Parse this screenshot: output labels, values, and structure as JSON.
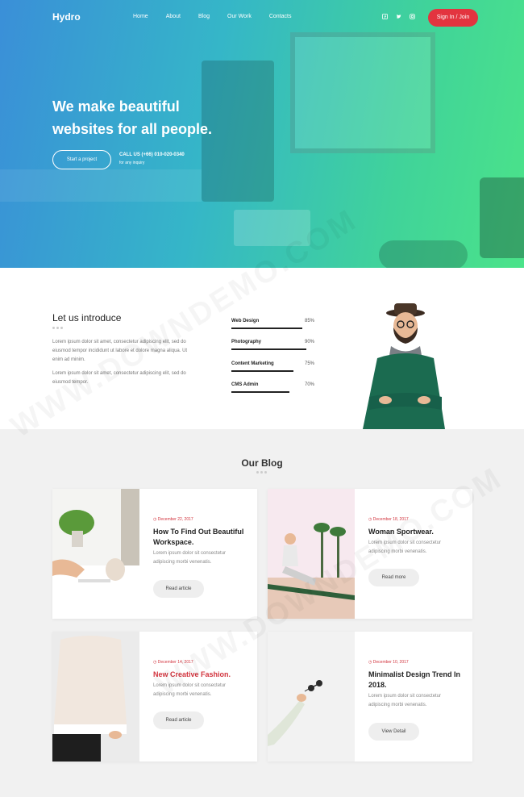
{
  "header": {
    "logo": "Hydro",
    "nav": [
      "Home",
      "About",
      "Blog",
      "Our Work",
      "Contacts"
    ],
    "social_icons": [
      "facebook-icon",
      "twitter-icon",
      "instagram-icon"
    ],
    "signin_label": "Sign In / Join"
  },
  "hero": {
    "title_line1": "We make beautiful",
    "title_line2": "websites for all people.",
    "cta_label": "Start a project",
    "call_label": "CALL US (+66) 010-020-0340",
    "call_sub": "for any inquiry"
  },
  "intro": {
    "title": "Let us introduce",
    "paragraph1": "Lorem ipsum dolor sit amet, consectetur adipiscing elit, sed do eiusmod tempor incididunt ut labore et dolore magna aliqua. Ut enim ad minim.",
    "paragraph2": "Lorem ipsum dolor sit amet, consectetur adipiscing elit, sed do eiusmod tempor.",
    "skills": [
      {
        "name": "Web Design",
        "percent": "85%",
        "value": 0.85
      },
      {
        "name": "Photography",
        "percent": "90%",
        "value": 0.9
      },
      {
        "name": "Content Marketing",
        "percent": "75%",
        "value": 0.75
      },
      {
        "name": "CMS Admin",
        "percent": "70%",
        "value": 0.7
      }
    ]
  },
  "blog": {
    "title": "Our Blog",
    "posts": [
      {
        "date": "December 22, 2017",
        "title": "How To Find Out Beautiful Workspace.",
        "excerpt": "Lorem ipsum dolor sit consectetur adipiscing morbi venenatis.",
        "button": "Read article"
      },
      {
        "date": "December 18, 2017",
        "title": "Woman Sportwear.",
        "excerpt": "Lorem ipsum dolor sit consectetur adipiscing morbi venenatis.",
        "button": "Read more"
      },
      {
        "date": "December 14, 2017",
        "title": "New Creative Fashion.",
        "excerpt": "Lorem ipsum dolor sit consectetur adipiscing morbi venenatis.",
        "button": "Read article"
      },
      {
        "date": "December 10, 2017",
        "title": "Minimalist Design Trend In 2018.",
        "excerpt": "Lorem ipsum dolor sit consectetur adipiscing morbi venenatis.",
        "button": "View Detail"
      }
    ]
  },
  "watermark": "WWW.DOWNDEMO.COM",
  "colors": {
    "accent": "#e3343f",
    "gradient_start": "#3a8fd8",
    "gradient_end": "#4be389"
  }
}
